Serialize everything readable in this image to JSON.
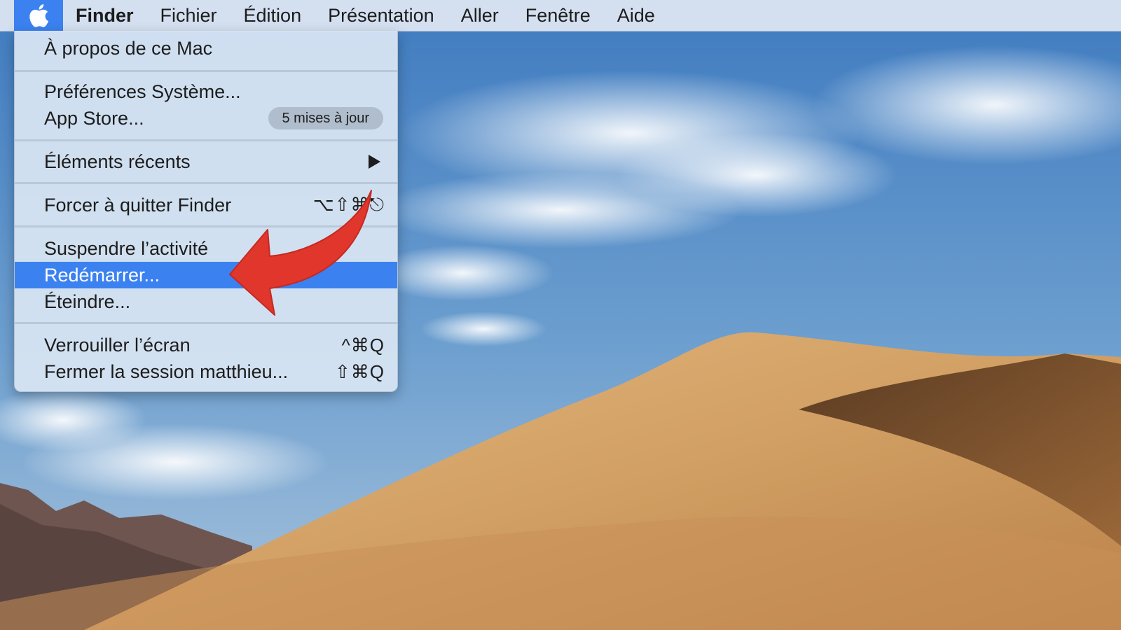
{
  "menubar": {
    "apple_icon": "apple-logo-icon",
    "app_name": "Finder",
    "items": [
      "Fichier",
      "Édition",
      "Présentation",
      "Aller",
      "Fenêtre",
      "Aide"
    ]
  },
  "apple_menu": {
    "about": "À propos de ce Mac",
    "system_prefs": "Préférences Système...",
    "app_store": "App Store...",
    "app_store_badge": "5 mises à jour",
    "recent_items": "Éléments récents",
    "force_quit": "Forcer à quitter Finder",
    "force_quit_shortcut": "⌥⇧⌘⎋",
    "sleep": "Suspendre l’activité",
    "restart": "Redémarrer...",
    "shutdown": "Éteindre...",
    "lock_screen": "Verrouiller l’écran",
    "lock_screen_shortcut": "^⌘Q",
    "logout": "Fermer la session matthieu...",
    "logout_shortcut": "⇧⌘Q"
  },
  "colors": {
    "highlight": "#3b82f0",
    "annotation_arrow": "#e0362c"
  }
}
